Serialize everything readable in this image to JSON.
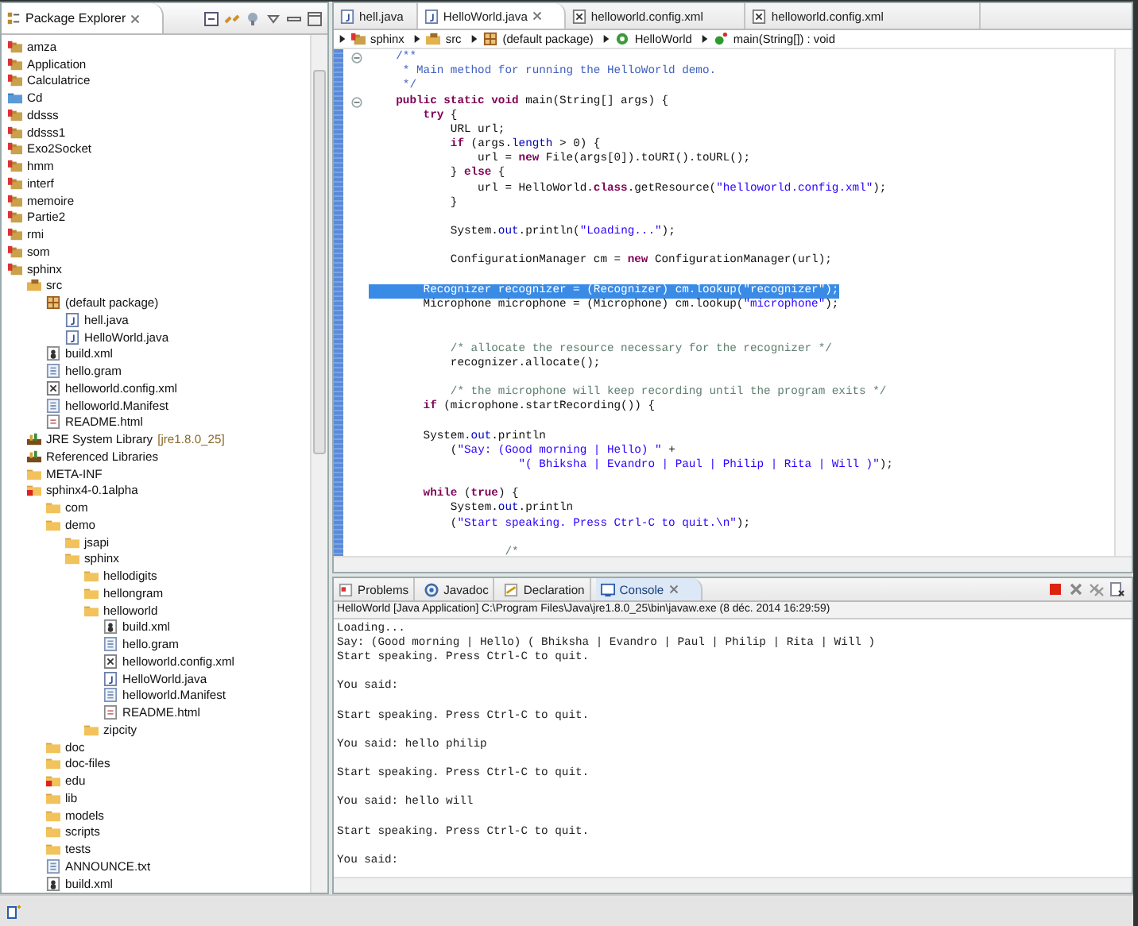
{
  "package_explorer": {
    "title": "Package Explorer",
    "tree": [
      {
        "label": "amza",
        "kind": "project"
      },
      {
        "label": "Application",
        "kind": "project"
      },
      {
        "label": "Calculatrice",
        "kind": "project"
      },
      {
        "label": "Cd",
        "kind": "folder_blue"
      },
      {
        "label": "ddsss",
        "kind": "project"
      },
      {
        "label": "ddsss1",
        "kind": "project"
      },
      {
        "label": "Exo2Socket",
        "kind": "project"
      },
      {
        "label": "hmm",
        "kind": "project"
      },
      {
        "label": "interf",
        "kind": "project"
      },
      {
        "label": "memoire",
        "kind": "project"
      },
      {
        "label": "Partie2",
        "kind": "project"
      },
      {
        "label": "rmi",
        "kind": "project"
      },
      {
        "label": "som",
        "kind": "project"
      },
      {
        "label": "sphinx",
        "kind": "project",
        "children": [
          {
            "label": "src",
            "kind": "source_folder",
            "children": [
              {
                "label": "(default package)",
                "kind": "package",
                "children": [
                  {
                    "label": "hell.java",
                    "kind": "java"
                  },
                  {
                    "label": "HelloWorld.java",
                    "kind": "java"
                  }
                ]
              },
              {
                "label": "build.xml",
                "kind": "ant"
              },
              {
                "label": "hello.gram",
                "kind": "text"
              },
              {
                "label": "helloworld.config.xml",
                "kind": "xml"
              },
              {
                "label": "helloworld.Manifest",
                "kind": "text"
              },
              {
                "label": "README.html",
                "kind": "html"
              }
            ]
          },
          {
            "label": "JRE System Library",
            "decoration": "[jre1.8.0_25]",
            "kind": "library"
          },
          {
            "label": "Referenced Libraries",
            "kind": "library"
          },
          {
            "label": "META-INF",
            "kind": "folder"
          },
          {
            "label": "sphinx4-0.1alpha",
            "kind": "folder_error",
            "children": [
              {
                "label": "com",
                "kind": "folder"
              },
              {
                "label": "demo",
                "kind": "folder",
                "children": [
                  {
                    "label": "jsapi",
                    "kind": "folder"
                  },
                  {
                    "label": "sphinx",
                    "kind": "folder",
                    "children": [
                      {
                        "label": "hellodigits",
                        "kind": "folder"
                      },
                      {
                        "label": "hellongram",
                        "kind": "folder"
                      },
                      {
                        "label": "helloworld",
                        "kind": "folder",
                        "children": [
                          {
                            "label": "build.xml",
                            "kind": "ant"
                          },
                          {
                            "label": "hello.gram",
                            "kind": "text"
                          },
                          {
                            "label": "helloworld.config.xml",
                            "kind": "xml"
                          },
                          {
                            "label": "HelloWorld.java",
                            "kind": "java"
                          },
                          {
                            "label": "helloworld.Manifest",
                            "kind": "text"
                          },
                          {
                            "label": "README.html",
                            "kind": "html"
                          }
                        ]
                      },
                      {
                        "label": "zipcity",
                        "kind": "folder"
                      }
                    ]
                  }
                ]
              },
              {
                "label": "doc",
                "kind": "folder"
              },
              {
                "label": "doc-files",
                "kind": "folder"
              },
              {
                "label": "edu",
                "kind": "folder_error"
              },
              {
                "label": "lib",
                "kind": "folder"
              },
              {
                "label": "models",
                "kind": "folder"
              },
              {
                "label": "scripts",
                "kind": "folder"
              },
              {
                "label": "tests",
                "kind": "folder"
              },
              {
                "label": "ANNOUNCE.txt",
                "kind": "text"
              },
              {
                "label": "build.xml",
                "kind": "ant"
              }
            ]
          }
        ]
      }
    ]
  },
  "editor_tabs": [
    {
      "label": "hell.java",
      "kind": "java",
      "selected": false
    },
    {
      "label": "HelloWorld.java",
      "kind": "java",
      "selected": true
    },
    {
      "label": "helloworld.config.xml",
      "kind": "xml",
      "selected": false
    },
    {
      "label": "helloworld.config.xml",
      "kind": "xml",
      "selected": false
    }
  ],
  "breadcrumb": [
    {
      "label": "sphinx",
      "kind": "project"
    },
    {
      "label": "src",
      "kind": "source_folder"
    },
    {
      "label": "(default package)",
      "kind": "package"
    },
    {
      "label": "HelloWorld",
      "kind": "class"
    },
    {
      "label": "main(String[]) : void",
      "kind": "method"
    }
  ],
  "code_lines": [
    {
      "kind": "code",
      "selected": false,
      "fold": true,
      "tokens": [
        {
          "kind": "javadoc",
          "text": "    /**"
        }
      ]
    },
    {
      "kind": "code",
      "selected": false,
      "fold": false,
      "tokens": [
        {
          "kind": "javadoc",
          "text": "     * Main method for running the HelloWorld demo."
        }
      ]
    },
    {
      "kind": "code",
      "selected": false,
      "fold": false,
      "tokens": [
        {
          "kind": "javadoc",
          "text": "     */"
        }
      ]
    },
    {
      "kind": "code",
      "selected": false,
      "fold": true,
      "tokens": [
        {
          "kind": "keyword",
          "text": "    public static void"
        },
        {
          "kind": "plain",
          "text": " main(String[] args) {"
        }
      ]
    },
    {
      "kind": "code",
      "selected": false,
      "fold": false,
      "tokens": [
        {
          "kind": "keyword",
          "text": "        try"
        },
        {
          "kind": "plain",
          "text": " {"
        }
      ]
    },
    {
      "kind": "code",
      "selected": false,
      "fold": false,
      "tokens": [
        {
          "kind": "plain",
          "text": "            URL url;"
        }
      ]
    },
    {
      "kind": "code",
      "selected": false,
      "fold": false,
      "tokens": [
        {
          "kind": "keyword",
          "text": "            if"
        },
        {
          "kind": "plain",
          "text": " (args."
        },
        {
          "kind": "field",
          "text": "length"
        },
        {
          "kind": "plain",
          "text": " > 0) {"
        }
      ]
    },
    {
      "kind": "code",
      "selected": false,
      "fold": false,
      "tokens": [
        {
          "kind": "plain",
          "text": "                url = "
        },
        {
          "kind": "keyword",
          "text": "new"
        },
        {
          "kind": "plain",
          "text": " File(args[0]).toURI().toURL();"
        }
      ]
    },
    {
      "kind": "code",
      "selected": false,
      "fold": false,
      "tokens": [
        {
          "kind": "plain",
          "text": "            } "
        },
        {
          "kind": "keyword",
          "text": "else"
        },
        {
          "kind": "plain",
          "text": " {"
        }
      ]
    },
    {
      "kind": "code",
      "selected": false,
      "fold": false,
      "tokens": [
        {
          "kind": "plain",
          "text": "                url = HelloWorld."
        },
        {
          "kind": "keyword",
          "text": "class"
        },
        {
          "kind": "plain",
          "text": ".getResource("
        },
        {
          "kind": "string",
          "text": "\"helloworld.config.xml\""
        },
        {
          "kind": "plain",
          "text": ");"
        }
      ]
    },
    {
      "kind": "code",
      "selected": false,
      "fold": false,
      "tokens": [
        {
          "kind": "plain",
          "text": "            }"
        }
      ]
    },
    {
      "kind": "blank"
    },
    {
      "kind": "code",
      "selected": false,
      "fold": false,
      "tokens": [
        {
          "kind": "plain",
          "text": "            System."
        },
        {
          "kind": "field",
          "text": "out"
        },
        {
          "kind": "plain",
          "text": ".println("
        },
        {
          "kind": "string",
          "text": "\"Loading...\""
        },
        {
          "kind": "plain",
          "text": ");"
        }
      ]
    },
    {
      "kind": "blank"
    },
    {
      "kind": "code",
      "selected": false,
      "fold": false,
      "tokens": [
        {
          "kind": "plain",
          "text": "            ConfigurationManager cm = "
        },
        {
          "kind": "keyword",
          "text": "new"
        },
        {
          "kind": "plain",
          "text": " ConfigurationManager(url);"
        }
      ]
    },
    {
      "kind": "blank"
    },
    {
      "kind": "code",
      "selected": true,
      "fold": false,
      "tokens": [
        {
          "kind": "plain",
          "text": "        Recognizer recognizer = (Recognizer) cm.lookup("
        },
        {
          "kind": "string",
          "text": "\"recognizer\""
        },
        {
          "kind": "plain",
          "text": ");"
        }
      ]
    },
    {
      "kind": "code",
      "selected": false,
      "fold": false,
      "tokens": [
        {
          "kind": "plain",
          "text": "        Microphone microphone = (Microphone) cm.lookup("
        },
        {
          "kind": "string",
          "text": "\"microphone\""
        },
        {
          "kind": "plain",
          "text": ");"
        }
      ]
    },
    {
      "kind": "blank"
    },
    {
      "kind": "blank"
    },
    {
      "kind": "code",
      "selected": false,
      "fold": false,
      "tokens": [
        {
          "kind": "comment",
          "text": "            /* allocate the resource necessary for the recognizer */"
        }
      ]
    },
    {
      "kind": "code",
      "selected": false,
      "fold": false,
      "tokens": [
        {
          "kind": "plain",
          "text": "            recognizer.allocate();"
        }
      ]
    },
    {
      "kind": "blank"
    },
    {
      "kind": "code",
      "selected": false,
      "fold": false,
      "tokens": [
        {
          "kind": "comment",
          "text": "            /* the microphone will keep recording until the program exits */"
        }
      ]
    },
    {
      "kind": "code",
      "selected": false,
      "fold": false,
      "tokens": [
        {
          "kind": "keyword",
          "text": "        if"
        },
        {
          "kind": "plain",
          "text": " (microphone.startRecording()) {"
        }
      ]
    },
    {
      "kind": "blank"
    },
    {
      "kind": "code",
      "selected": false,
      "fold": false,
      "tokens": [
        {
          "kind": "plain",
          "text": "        System."
        },
        {
          "kind": "field",
          "text": "out"
        },
        {
          "kind": "plain",
          "text": ".println"
        }
      ]
    },
    {
      "kind": "code",
      "selected": false,
      "fold": false,
      "tokens": [
        {
          "kind": "plain",
          "text": "            ("
        },
        {
          "kind": "string",
          "text": "\"Say: (Good morning | Hello) \""
        },
        {
          "kind": "plain",
          "text": " +"
        }
      ]
    },
    {
      "kind": "code",
      "selected": false,
      "fold": false,
      "tokens": [
        {
          "kind": "string",
          "text": "                      \"( Bhiksha | Evandro | Paul | Philip | Rita | Will )\""
        },
        {
          "kind": "plain",
          "text": ");"
        }
      ]
    },
    {
      "kind": "blank"
    },
    {
      "kind": "code",
      "selected": false,
      "fold": false,
      "tokens": [
        {
          "kind": "keyword",
          "text": "        while"
        },
        {
          "kind": "plain",
          "text": " ("
        },
        {
          "kind": "keyword",
          "text": "true"
        },
        {
          "kind": "plain",
          "text": ") {"
        }
      ]
    },
    {
      "kind": "code",
      "selected": false,
      "fold": false,
      "tokens": [
        {
          "kind": "plain",
          "text": "            System."
        },
        {
          "kind": "field",
          "text": "out"
        },
        {
          "kind": "plain",
          "text": ".println"
        }
      ]
    },
    {
      "kind": "code",
      "selected": false,
      "fold": false,
      "tokens": [
        {
          "kind": "plain",
          "text": "            ("
        },
        {
          "kind": "string",
          "text": "\"Start speaking. Press Ctrl-C to quit.\\n\""
        },
        {
          "kind": "plain",
          "text": ");"
        }
      ]
    },
    {
      "kind": "blank"
    },
    {
      "kind": "code",
      "selected": false,
      "fold": false,
      "tokens": [
        {
          "kind": "comment",
          "text": "                    /*"
        }
      ]
    }
  ],
  "bottom_tabs": [
    {
      "label": "Problems",
      "kind": "problems",
      "selected": false
    },
    {
      "label": "Javadoc",
      "kind": "javadoc",
      "selected": false
    },
    {
      "label": "Declaration",
      "kind": "declaration",
      "selected": false
    },
    {
      "label": "Console",
      "kind": "console",
      "selected": true
    }
  ],
  "console": {
    "header": "HelloWorld [Java Application] C:\\Program Files\\Java\\jre1.8.0_25\\bin\\javaw.exe (8 déc. 2014 16:29:59)",
    "lines": [
      {
        "kind": "text",
        "text": "Loading..."
      },
      {
        "kind": "text",
        "text": "Say: (Good morning | Hello) ( Bhiksha | Evandro | Paul | Philip | Rita | Will )"
      },
      {
        "kind": "text",
        "text": "Start speaking. Press Ctrl-C to quit."
      },
      {
        "kind": "blank"
      },
      {
        "kind": "text",
        "text": "You said:"
      },
      {
        "kind": "blank"
      },
      {
        "kind": "text",
        "text": "Start speaking. Press Ctrl-C to quit."
      },
      {
        "kind": "blank"
      },
      {
        "kind": "text",
        "text": "You said: hello philip"
      },
      {
        "kind": "blank"
      },
      {
        "kind": "text",
        "text": "Start speaking. Press Ctrl-C to quit."
      },
      {
        "kind": "blank"
      },
      {
        "kind": "text",
        "text": "You said: hello will"
      },
      {
        "kind": "blank"
      },
      {
        "kind": "text",
        "text": "Start speaking. Press Ctrl-C to quit."
      },
      {
        "kind": "blank"
      },
      {
        "kind": "text",
        "text": "You said:"
      }
    ]
  }
}
